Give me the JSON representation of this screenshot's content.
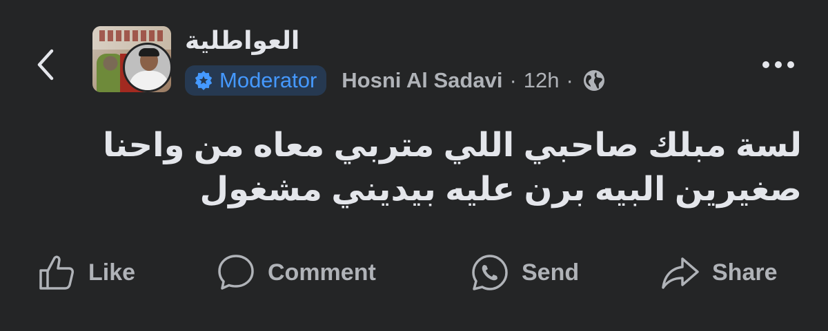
{
  "header": {
    "group_name": "العواطلية",
    "badge_label": "Moderator",
    "author_name": "Hosni Al Sadavi",
    "separator": "·",
    "time": "12h",
    "privacy_icon": "globe-icon"
  },
  "post": {
    "lines": [
      "لسة مبلك صاحبي اللي متربي معاه من واحنا",
      "صغيرين البيه برن عليه بيديني مشغول"
    ]
  },
  "actions": {
    "like": "Like",
    "comment": "Comment",
    "send": "Send",
    "share": "Share"
  },
  "colors": {
    "background": "#242526",
    "primary_text": "#e4e6eb",
    "secondary_text": "#b0b3b8",
    "badge_bg": "#263951",
    "badge_text": "#4599ff"
  }
}
